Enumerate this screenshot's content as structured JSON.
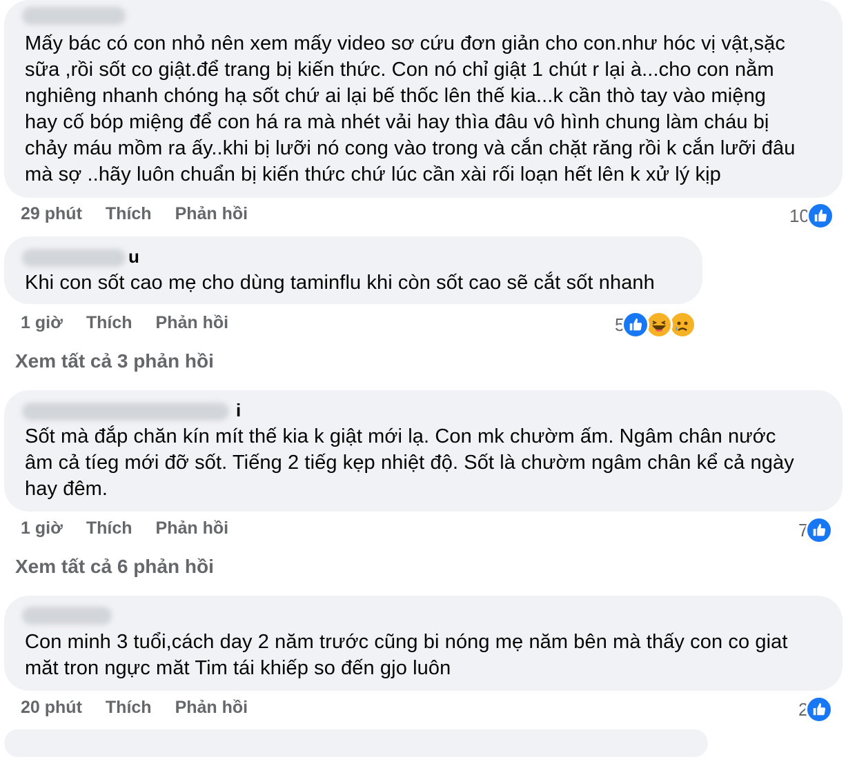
{
  "comments": [
    {
      "text": "Mấy bác có con nhỏ nên xem mấy video sơ cứu đơn giản cho con.như hóc vị vật,sặc\nsữa ,rồi sốt co giật.để trang bị kiến thức. Con nó chỉ giật 1 chút r lại à...cho con nằm\nnghiêng nhanh chóng hạ sốt chứ ai lại bế thốc lên thế kia...k cần thò tay vào miệng\nhay cố bóp miệng để con há ra mà nhét vải hay thìa đâu vô hình chung làm cháu bị\nchảy máu mồm ra ấy..khi bị lưỡi nó cong vào trong và cắn chặt răng rồi k cắn lưỡi đâu\nmà sợ ..hãy luôn chuẩn bị kiến thức chứ lúc cần xài rối loạn hết lên k xử lý kịp",
      "time": "29 phút",
      "like_label": "Thích",
      "reply_label": "Phản hồi",
      "reaction_count": "10"
    },
    {
      "author_tail": "u",
      "text": "Khi con sốt cao mẹ cho dùng taminflu khi còn sốt cao sẽ cắt sốt nhanh",
      "time": "1 giờ",
      "like_label": "Thích",
      "reply_label": "Phản hồi",
      "reaction_count": "5"
    },
    {
      "author_tail": "i",
      "text": "Sốt mà đắp chăn kín mít thế kia k giật mới lạ. Con mk chườm ấm. Ngâm chân nước\nâm cả tíeg mới đỡ sốt. Tiếng 2 tiếg kẹp nhiệt độ. Sốt là chườm ngâm chân kể cả ngày\nhay đêm.",
      "time": "1 giờ",
      "like_label": "Thích",
      "reply_label": "Phản hồi",
      "reaction_count": "7"
    },
    {
      "text": "Con minh 3 tuổi,cách day 2 năm trước cũng bi nóng mẹ năm bên mà thấy con co giat\nmăt tron ngực măt Tim tái khiếp so đến gjo luôn",
      "time": "20 phút",
      "like_label": "Thích",
      "reply_label": "Phản hồi",
      "reaction_count": "2"
    }
  ],
  "view_more": [
    "Xem tất cả 3 phản hồi",
    "Xem tất cả 6 phản hồi"
  ],
  "colors": {
    "bubble": "#f0f2f5",
    "meta_text": "#65676b",
    "like_blue": "#1877f2",
    "emoji_yellow": "#f7b125"
  },
  "icons": [
    "like-icon",
    "haha-icon",
    "sad-icon"
  ]
}
